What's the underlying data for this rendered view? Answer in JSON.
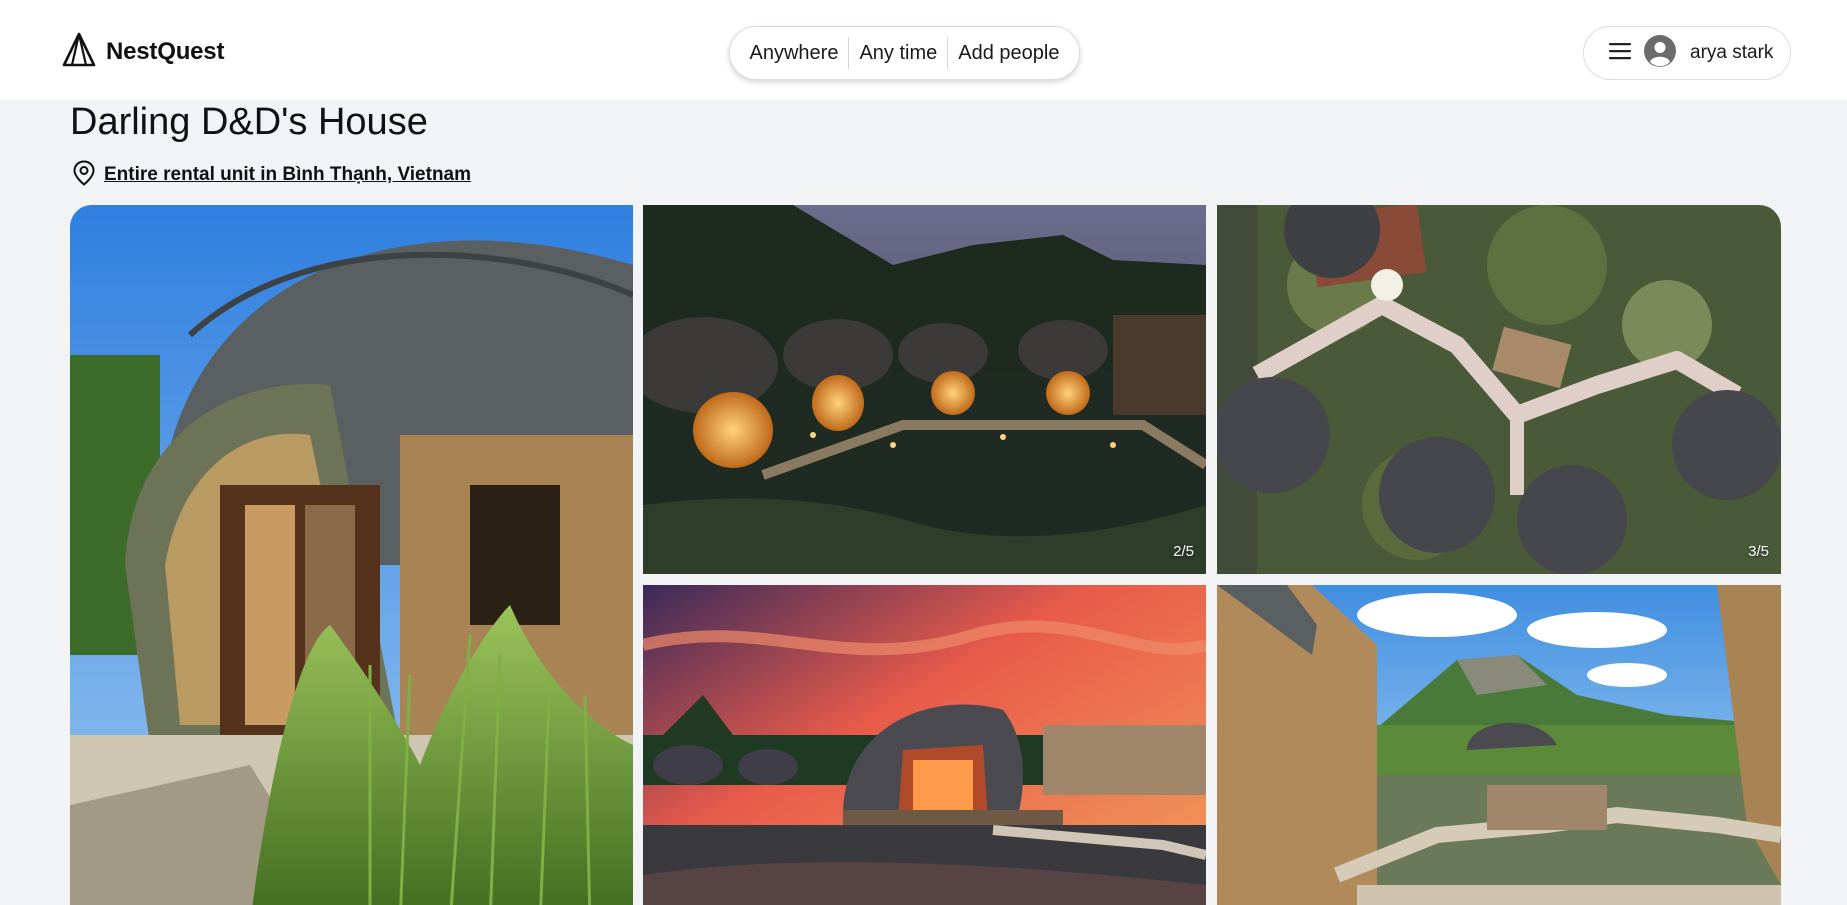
{
  "brand": {
    "name": "NestQuest",
    "icon": "tent-icon"
  },
  "search": {
    "where": "Anywhere",
    "when": "Any time",
    "who": "Add people"
  },
  "user": {
    "name": "arya stark",
    "menu_icon": "hamburger-icon",
    "avatar_icon": "user-avatar-icon"
  },
  "listing": {
    "title": "Darling D&D's House",
    "location_icon": "map-pin-icon",
    "location": "Entire rental unit in Bình Thạnh, Vietnam"
  },
  "photos": [
    {
      "alt": "dome house with reeds",
      "counter": ""
    },
    {
      "alt": "domes over lotus pond at night",
      "counter": "2/5"
    },
    {
      "alt": "aerial view of domes and walkways",
      "counter": "3/5"
    },
    {
      "alt": "dome at sunset over pond",
      "counter": ""
    },
    {
      "alt": "domes with walkways and mountain",
      "counter": ""
    }
  ],
  "colors": {
    "page_bg": "#f2f3f5",
    "header_bg": "#ffffff",
    "text": "#111111"
  }
}
